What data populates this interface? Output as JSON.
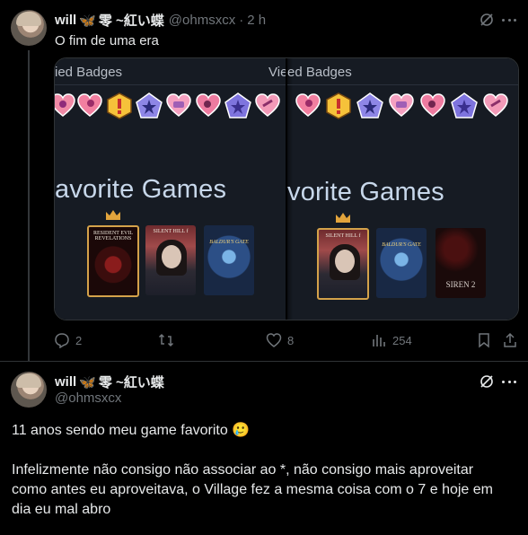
{
  "post1": {
    "author_name": "will",
    "author_extra": "零 ~紅い蝶",
    "handle": "@ohmsxcx",
    "dot": "·",
    "time": "2 h",
    "text": "O fim de uma era",
    "media": {
      "left": {
        "badges_title": "ied Badges",
        "badges_title_right": "Vie",
        "favorite_title": "avorite Games",
        "covers": [
          {
            "title": "RESIDENT EVIL REVELATIONS",
            "selected": true
          },
          {
            "title": "SILENT HILL f",
            "selected": false
          },
          {
            "title": "BALDUR'S GATE",
            "selected": false
          }
        ]
      },
      "right": {
        "badges_title": "ed Badges",
        "favorite_title": "vorite Games",
        "covers": [
          {
            "title": "SILENT HILL f",
            "selected": true
          },
          {
            "title": "BALDUR'S GATE",
            "selected": false
          },
          {
            "title": "SIREN 2",
            "selected": false
          }
        ]
      }
    },
    "actions": {
      "replies": "2",
      "reposts": "",
      "likes": "8",
      "views": "254"
    }
  },
  "post2": {
    "author_name": "will",
    "author_extra": "零 ~紅い蝶",
    "handle": "@ohmsxcx",
    "paragraph1": "11 anos sendo meu game favorito 🥲",
    "paragraph2_line1": "Infelizmente não consigo não associar ao *, não consigo mais aproveitar",
    "paragraph2_line2": "como antes eu aproveitava, o Village fez a mesma coisa com o 7 e hoje em",
    "paragraph2_line3": "dia eu mal abro"
  },
  "icons": {
    "butterfly": "🦋",
    "grok": "grok-icon",
    "more": "more-icon",
    "reply": "reply-icon",
    "repost": "repost-icon",
    "like": "heart-icon",
    "views": "views-icon",
    "bookmark": "bookmark-icon",
    "share": "share-icon"
  },
  "colors": {
    "background": "#000000",
    "text": "#e7e9ea",
    "muted": "#71767b",
    "border": "#2f3336",
    "accent_gold": "#d4a24a"
  }
}
